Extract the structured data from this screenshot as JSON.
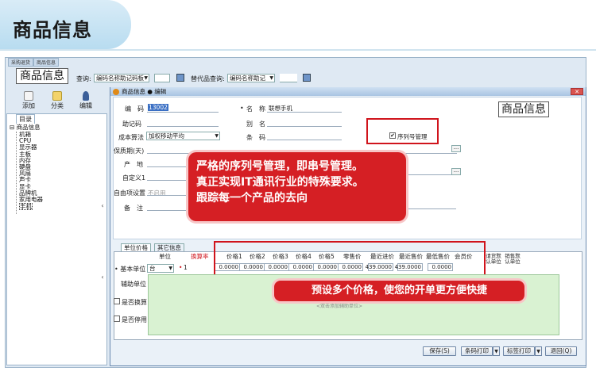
{
  "banner": {
    "title": "商品信息"
  },
  "app": {
    "tabs": [
      "采购退货",
      "商品信息"
    ],
    "page_title": "商品信息",
    "query_label": "查询:",
    "query_value": "编码名称助记码板",
    "alt_query_label": "替代品查询:",
    "alt_query_value": "编码名称助记",
    "toolbar": {
      "add": "添加",
      "category": "分类",
      "edit": "编辑"
    },
    "tree_tab": "目录",
    "tree_root": "商品信息",
    "tree_items": [
      "机箱",
      "CPU",
      "显示器",
      "主板",
      "内存",
      "硬盘",
      "风扇",
      "声卡",
      "显卡",
      "品牌机",
      "家用电器",
      "手机"
    ]
  },
  "dialog": {
    "title": "商品信息 ● 编辑",
    "close": "✕",
    "fields": {
      "code_label": "编　码",
      "code_value": "13002",
      "mnemonic_label": "助记码",
      "cost_label": "成本算法",
      "cost_value": "加权移动平均",
      "shelf_label": "保质期(天)",
      "origin_label": "产　地",
      "custom_label": "自定义1",
      "custom_settings_label": "自由项设置",
      "custom_settings_value": "不启用",
      "remark_label": "备　注",
      "name_label": "名　称",
      "name_value": "联想手机",
      "alias_label": "别　名",
      "barcode_label": "条　码",
      "serial_label": "序列号管理",
      "serial_checked": "✔",
      "required_mark": "•"
    },
    "title_box": "商品信息",
    "lower_tabs": [
      "单位价格",
      "其它信息"
    ],
    "grid": {
      "basic_unit_label": "• 基本单位",
      "headers": [
        "单位",
        "换算率",
        "价格1",
        "价格2",
        "价格3",
        "价格4",
        "价格5",
        "零售价",
        "最近进价",
        "最近售价",
        "最低售价",
        "会员价",
        "请货默认单位",
        "销售默认单位"
      ],
      "unit_value": "台",
      "rate_value": "1",
      "prices": [
        "0.0000",
        "0.0000",
        "0.0000",
        "0.0000",
        "0.0000",
        "0.0000",
        "439.0000",
        "439.0000",
        "0.0000"
      ],
      "aux_unit_label": "辅助单位",
      "convert_label": "是否换算",
      "disable_label": "是否停用",
      "placeholder": "<双击添加辅助单位>"
    },
    "buttons": {
      "save": "保存(S)",
      "barcode_print": "条码打印",
      "label_print": "标签打印",
      "exit": "退回(Q)"
    }
  },
  "callouts": {
    "serial": [
      "严格的序列号管理，即串号管理。",
      "真正实现IT通讯行业的特殊要求。",
      "跟踪每一个产品的去向"
    ],
    "prices": "预设多个价格，使您的开单更方便快捷"
  }
}
